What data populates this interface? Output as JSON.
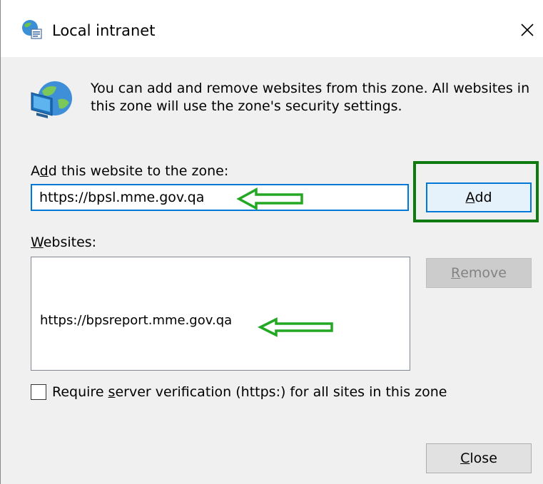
{
  "window": {
    "title": "Local intranet",
    "close_glyph": "✕"
  },
  "description": "You can add and remove websites from this zone. All websites in this zone will use the zone's security settings.",
  "add_section": {
    "label_prefix": "A",
    "label_mnemonic": "d",
    "label_suffix": "d this website to the zone:",
    "input_value": "https://bpsl.mme.gov.qa",
    "add_button_mnemonic": "A",
    "add_button_rest": "dd"
  },
  "websites_section": {
    "label_mnemonic": "W",
    "label_rest": "ebsites:",
    "items": [
      "https://bpsreport.mme.gov.qa"
    ],
    "remove_button_mnemonic": "R",
    "remove_button_rest": "emove"
  },
  "verification": {
    "label_prefix": "Require ",
    "label_mnemonic": "s",
    "label_suffix": "erver verification (https:) for all sites in this zone",
    "checked": false
  },
  "footer": {
    "close_button_mnemonic": "C",
    "close_button_rest": "lose"
  },
  "icons": {
    "title": "intranet-zone-icon",
    "zone": "globe-computer-icon",
    "close": "close-icon",
    "annotation_arrow": "arrow-left-icon"
  },
  "colors": {
    "annotation_green": "#22a822",
    "highlight_green": "#0f7a0f",
    "focus_blue": "#0078d7",
    "dialog_bg": "#f0f0f0"
  }
}
